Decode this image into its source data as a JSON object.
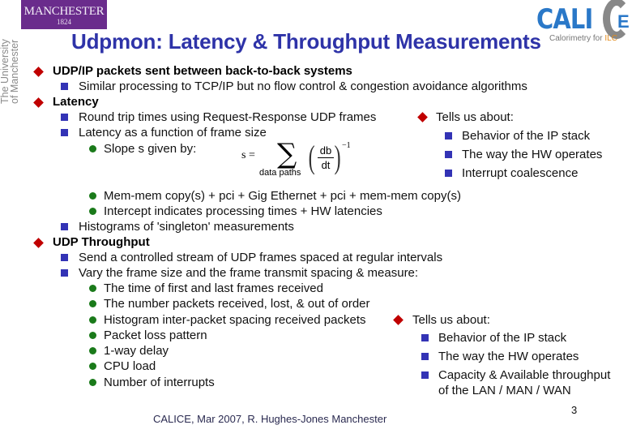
{
  "logos": {
    "manchester_name": "MANCHESTER",
    "manchester_year": "1824",
    "university_line1": "The University",
    "university_line2": "of Manchester",
    "calice_text": "CALI",
    "calice_e": "E",
    "calice_sub_prefix": "Calorimetry ",
    "calice_sub_for": "for ",
    "calice_sub_ilc": "ILC"
  },
  "title": "Udpmon: Latency & Throughput Measurements",
  "sections": {
    "s1": {
      "heading": "UDP/IP packets sent between back-to-back systems",
      "items": [
        "Similar processing to TCP/IP but no flow control & congestion avoidance algorithms"
      ]
    },
    "s2": {
      "heading": "Latency",
      "items": [
        "Round trip times using Request-Response UDP frames",
        "Latency as a function of frame size"
      ],
      "slope_label": "Slope s given by:",
      "subitems": [
        "Mem-mem copy(s) + pci + Gig Ethernet + pci + mem-mem copy(s)",
        "Intercept indicates processing times + HW latencies"
      ],
      "last_item": "Histograms of 'singleton' measurements",
      "tells": {
        "heading": "Tells us about:",
        "items": [
          "Behavior of the IP stack",
          "The way the HW operates",
          "Interrupt coalescence"
        ]
      }
    },
    "s3": {
      "heading": "UDP Throughput",
      "items": [
        "Send a controlled stream of UDP frames spaced at regular intervals",
        "Vary the frame size and the frame transmit spacing & measure:"
      ],
      "subitems": [
        "The time of first and last frames received",
        "The number packets received, lost, & out of order",
        "Histogram inter-packet spacing received packets",
        "Packet loss pattern",
        "1-way delay",
        "CPU load",
        "Number of interrupts"
      ],
      "tells": {
        "heading": "Tells us about:",
        "items": [
          "Behavior of the IP stack",
          "The way the HW operates",
          "Capacity & Available throughput",
          "of the LAN / MAN / WAN"
        ]
      }
    }
  },
  "formula": {
    "lhs": "s =",
    "sigma": "∑",
    "under": "data paths",
    "num": "db",
    "den": "dt",
    "exp": "−1"
  },
  "footer": "CALICE, Mar 2007,  R. Hughes-Jones  Manchester",
  "page_number": "3"
}
